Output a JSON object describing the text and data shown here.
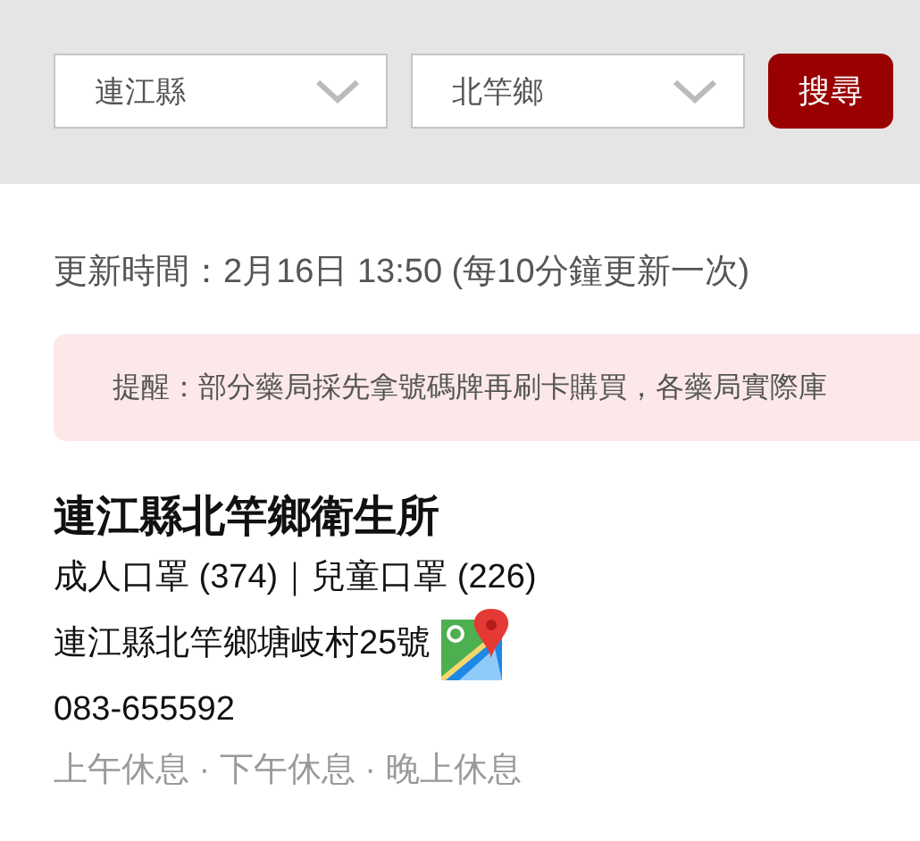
{
  "search_bar": {
    "selects": [
      {
        "value": "連江縣"
      },
      {
        "value": "北竿鄉"
      }
    ],
    "button": "搜尋"
  },
  "updated": "更新時間：2月16日 13:50 (每10分鐘更新一次)",
  "notice": "提醒：部分藥局採先拿號碼牌再刷卡購買，各藥局實際庫",
  "pharmacy": {
    "name": "連江縣北竿鄉衛生所",
    "stock": "成人口罩 (374)｜兒童口罩 (226)",
    "address": "連江縣北竿鄉塘岐村25號",
    "phone": "083-655592",
    "hours": "上午休息 · 下午休息 · 晚上休息"
  }
}
